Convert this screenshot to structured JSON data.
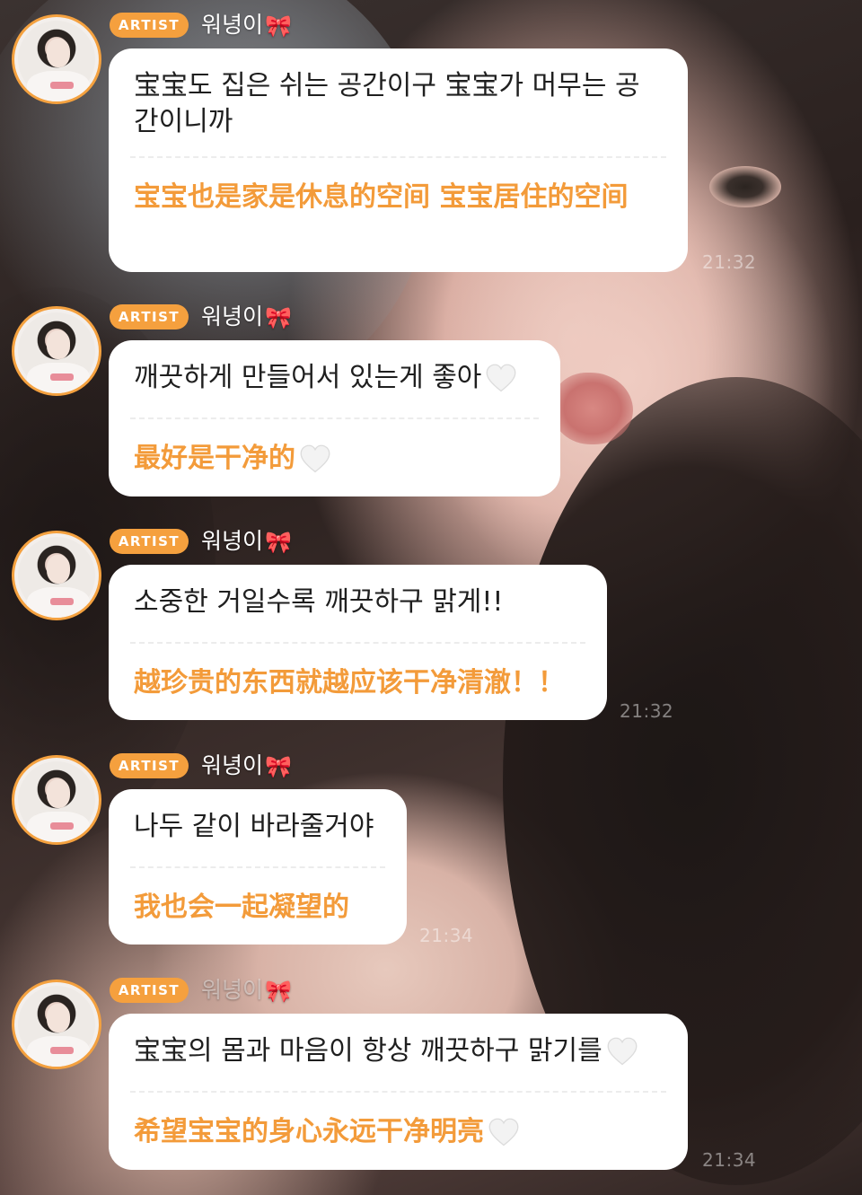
{
  "chat": {
    "messages": [
      {
        "badge": "ARTIST",
        "sender": "워녕이",
        "sender_emoji": "🎀",
        "korean": "宝宝도 집은 쉬는 공간이구 宝宝가 머무는 공간이니까",
        "chinese": "宝宝也是家是休息的空间 宝宝居住的空间",
        "time": "21:32"
      },
      {
        "badge": "ARTIST",
        "sender": "워녕이",
        "sender_emoji": "🎀",
        "korean": "깨끗하게 만들어서 있는게 좋아",
        "chinese": "最好是干净的",
        "heart": "white-heart"
      },
      {
        "badge": "ARTIST",
        "sender": "워녕이",
        "sender_emoji": "🎀",
        "korean": "소중한 거일수록 깨끗하구 맑게!!",
        "chinese": "越珍贵的东西就越应该干净清澈！！",
        "time": "21:32"
      },
      {
        "badge": "ARTIST",
        "sender": "워녕이",
        "sender_emoji": "🎀",
        "korean": "나두 같이 바라줄거야",
        "chinese": "我也会一起凝望的",
        "time": "21:34"
      },
      {
        "badge": "ARTIST",
        "sender": "워녕이",
        "sender_emoji": "🎀",
        "korean": "宝宝의 몸과 마음이 항상 깨끗하구 맑기를",
        "chinese": "希望宝宝的身心永远干净明亮",
        "heart": "white-heart",
        "time": "21:34"
      }
    ]
  },
  "colors": {
    "accent": "#f5a03e",
    "translation_text": "#f39b3a",
    "bubble": "#ffffff",
    "badge_text": "#ffffff"
  }
}
